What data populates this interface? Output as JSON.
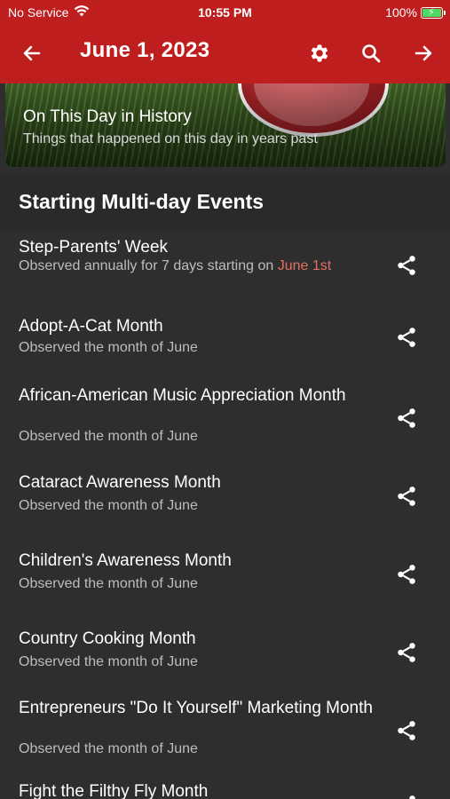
{
  "status": {
    "carrier": "No Service",
    "time": "10:55 PM",
    "battery": "100%"
  },
  "nav": {
    "title": "June 1, 2023"
  },
  "banner": {
    "title": "On This Day in History",
    "subtitle": "Things that happened on this day in years past"
  },
  "section": {
    "heading": "Starting Multi-day Events"
  },
  "events": [
    {
      "title": "Step-Parents' Week",
      "sub_prefix": "Observed annually for 7 days starting on ",
      "sub_link": "June 1st"
    },
    {
      "title": "Adopt-A-Cat Month",
      "subtitle": "Observed the month of June"
    },
    {
      "title": "African-American Music Appreciation Month",
      "subtitle": "Observed the month of June"
    },
    {
      "title": "Cataract Awareness Month",
      "subtitle": "Observed the month of June"
    },
    {
      "title": "Children's Awareness Month",
      "subtitle": "Observed the month of June"
    },
    {
      "title": "Country Cooking Month",
      "subtitle": "Observed the month of June"
    },
    {
      "title": "Entrepreneurs \"Do It Yourself\" Marketing Month",
      "subtitle": "Observed the month of June"
    },
    {
      "title": "Fight the Filthy Fly Month",
      "subtitle": ""
    }
  ],
  "colors": {
    "accent": "#bf1e1e",
    "background": "#2e2e2e",
    "link": "#e07063"
  },
  "icons": {
    "back": "arrow-left-icon",
    "settings": "gear-icon",
    "search": "search-icon",
    "forward": "arrow-right-icon",
    "share": "share-icon"
  }
}
